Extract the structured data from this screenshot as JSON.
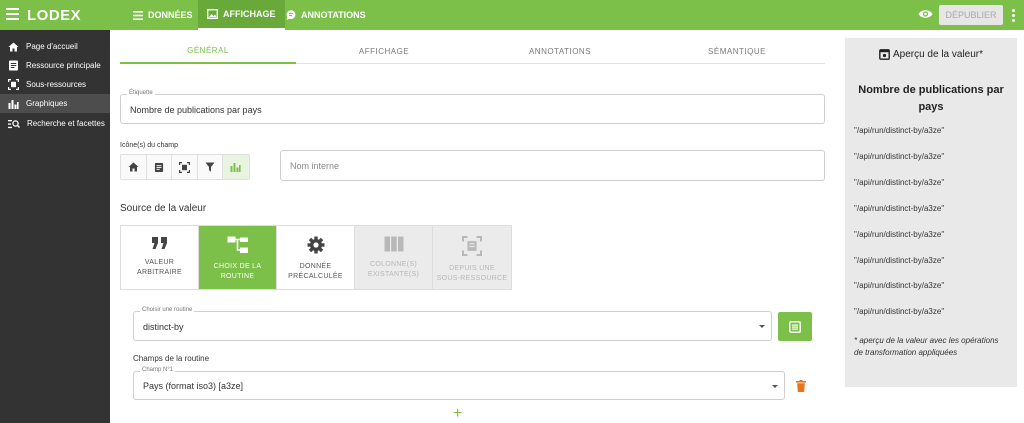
{
  "app": {
    "brand": "LODEX"
  },
  "nav": {
    "tabs": [
      {
        "label": "DONNÉES",
        "icon": "list-icon"
      },
      {
        "label": "AFFICHAGE",
        "icon": "image-icon"
      },
      {
        "label": "ANNOTATIONS",
        "icon": "comment-icon"
      }
    ],
    "active_tab": "AFFICHAGE",
    "publish_label": "DÉPUBLIER"
  },
  "sidebar": {
    "items": [
      {
        "label": "Page d'accueil",
        "icon": "home-icon"
      },
      {
        "label": "Ressource principale",
        "icon": "document-icon"
      },
      {
        "label": "Sous-ressources",
        "icon": "subresource-icon"
      },
      {
        "label": "Graphiques",
        "icon": "bar-chart-icon"
      },
      {
        "label": "Recherche et facettes",
        "icon": "search-list-icon"
      }
    ],
    "active": "Graphiques"
  },
  "tabs": {
    "items": [
      "GÉNÉRAL",
      "AFFICHAGE",
      "ANNOTATIONS",
      "SÉMANTIQUE"
    ],
    "active": "GÉNÉRAL"
  },
  "form": {
    "label_field": {
      "label": "Étiquette",
      "value": "Nombre de publications par pays"
    },
    "icons_label": "Icône(s) du champ",
    "icons": [
      "home-icon",
      "document-icon",
      "subresource-icon",
      "filter-icon",
      "bar-chart-icon"
    ],
    "icons_active": "bar-chart-icon",
    "internal_name_placeholder": "Nom interne",
    "source_title": "Source de la valeur",
    "sources": [
      {
        "line1": "VALEUR",
        "line2": "ARBITRAIRE",
        "state": "normal"
      },
      {
        "line1": "CHOIX DE LA",
        "line2": "ROUTINE",
        "state": "selected"
      },
      {
        "line1": "DONNÉE",
        "line2": "PRÉCALCULÉE",
        "state": "normal"
      },
      {
        "line1": "COLONNE(S)",
        "line2": "EXISTANTE(S)",
        "state": "disabled"
      },
      {
        "line1": "DEPUIS UNE",
        "line2": "SOUS-RESSOURCE",
        "state": "disabled"
      }
    ],
    "routine": {
      "label": "Choisir une routine",
      "value": "distinct-by"
    },
    "routine_fields_title": "Champs de la routine",
    "routine_field": {
      "label": "Champ N°1",
      "value": "Pays (format iso3) [a3ze]"
    }
  },
  "preview": {
    "title": "Aperçu de la valeur*",
    "heading": "Nombre de publications par pays",
    "rows": [
      "\"/api/run/distinct-by/a3ze\"",
      "\"/api/run/distinct-by/a3ze\"",
      "\"/api/run/distinct-by/a3ze\"",
      "\"/api/run/distinct-by/a3ze\"",
      "\"/api/run/distinct-by/a3ze\"",
      "\"/api/run/distinct-by/a3ze\"",
      "\"/api/run/distinct-by/a3ze\"",
      "\"/api/run/distinct-by/a3ze\""
    ],
    "note": "* aperçu de la valeur avec les opérations de transformation appliquées"
  },
  "colors": {
    "primary": "#7cbf49",
    "sidebar": "#333333",
    "preview_bg": "#e9e9e9"
  }
}
